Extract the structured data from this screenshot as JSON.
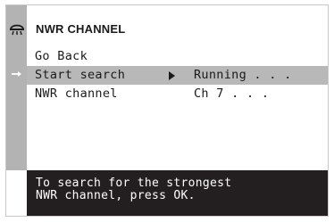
{
  "header": {
    "title": "NWR CHANNEL",
    "icon": "weather-radio-icon"
  },
  "menu": {
    "items": [
      {
        "label": "Go Back",
        "value": "",
        "selected": false
      },
      {
        "label": "Start search",
        "value": "Running . . .",
        "selected": true,
        "icon": "right-arrow-icon"
      },
      {
        "label": "NWR channel",
        "value": "Ch 7 . . .",
        "selected": false
      }
    ]
  },
  "help": {
    "line1": "To search for the strongest",
    "line2": "NWR channel, press OK."
  },
  "colors": {
    "sidebar": "#b3b3b3",
    "selected_row": "#b8b8b8",
    "help_background": "#231f20",
    "help_text": "#ffffff",
    "text": "#1a1a1a"
  }
}
